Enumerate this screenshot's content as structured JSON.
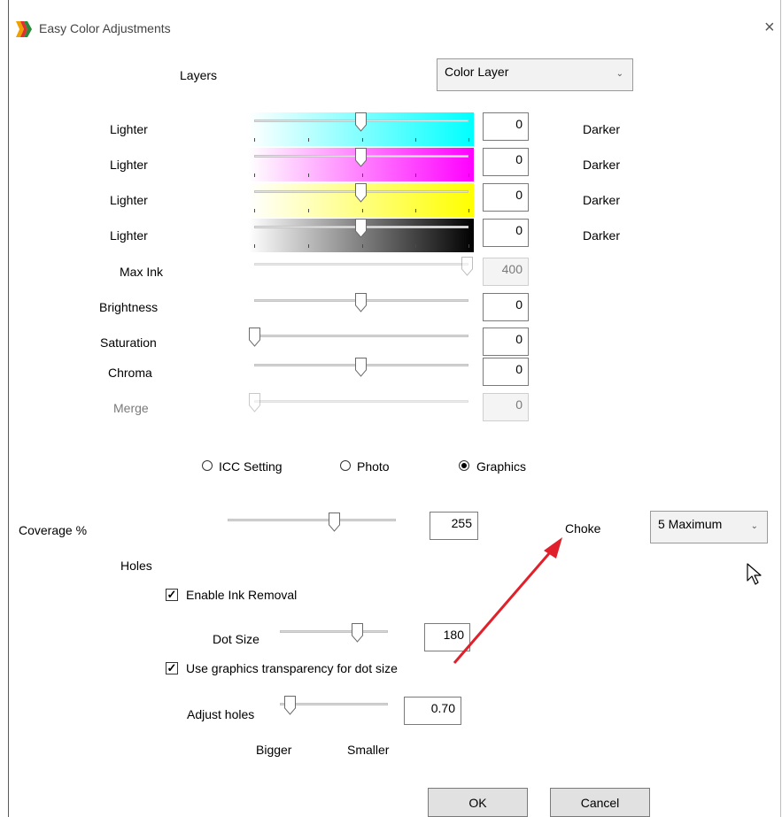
{
  "window": {
    "title": "Easy Color Adjustments",
    "close_glyph": "×"
  },
  "layers": {
    "label": "Layers",
    "selected": "Color Layer"
  },
  "color_rows": [
    {
      "left": "Lighter",
      "value": "0",
      "right": "Darker",
      "color": "#00ffff"
    },
    {
      "left": "Lighter",
      "value": "0",
      "right": "Darker",
      "color": "#ff00ff"
    },
    {
      "left": "Lighter",
      "value": "0",
      "right": "Darker",
      "color": "#ffff00"
    },
    {
      "left": "Lighter",
      "value": "0",
      "right": "Darker",
      "color": "#000000"
    }
  ],
  "sliders": {
    "max_ink": {
      "label": "Max Ink",
      "value": "400"
    },
    "brightness": {
      "label": "Brightness",
      "value": "0"
    },
    "saturation": {
      "label": "Saturation",
      "value": "0"
    },
    "chroma": {
      "label": "Chroma",
      "value": "0"
    },
    "merge": {
      "label": "Merge",
      "value": "0"
    }
  },
  "mode": {
    "options": [
      "ICC Setting",
      "Photo",
      "Graphics"
    ],
    "selected": "Graphics"
  },
  "coverage": {
    "label": "Coverage %",
    "value": "255"
  },
  "choke": {
    "label": "Choke",
    "selected": "5 Maximum"
  },
  "holes": {
    "label": "Holes",
    "enable_ink_removal": {
      "label": "Enable Ink Removal",
      "checked": true
    },
    "dot_size": {
      "label": "Dot Size",
      "value": "180"
    },
    "use_transparency": {
      "label": "Use graphics transparency for dot size",
      "checked": true
    },
    "adjust_holes": {
      "label": "Adjust holes",
      "value": "0.70"
    },
    "bigger": "Bigger",
    "smaller": "Smaller"
  },
  "buttons": {
    "ok": "OK",
    "cancel": "Cancel"
  },
  "colors": {
    "arrow": "#e0202a",
    "window_bg": "#ffffff"
  }
}
